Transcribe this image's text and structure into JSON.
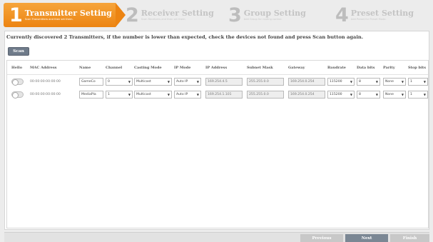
{
  "steps": [
    {
      "num": "1",
      "title": "Transmitter Setting",
      "sub": "Scan Transmitters and then set them."
    },
    {
      "num": "2",
      "title": "Receiver Setting",
      "sub": "Scan Receivers and then set them."
    },
    {
      "num": "3",
      "title": "Group Setting",
      "sub": "Add Group for routing control."
    },
    {
      "num": "4",
      "title": "Preset Setting",
      "sub": "Add Preset for Preset Mode."
    }
  ],
  "notice": "Currently discovered 2 Transmitters, if the number is lower than expected, check the devices not found and press Scan button again.",
  "scan_label": "Scan",
  "columns": [
    "Hello",
    "MAC Address",
    "Name",
    "Channel",
    "Casting Mode",
    "IP Mode",
    "IP Address",
    "Subnet Mask",
    "Gateway",
    "Baudrate",
    "Data bits",
    "Parity",
    "Stop bits"
  ],
  "rows": [
    {
      "mac": "00:00:00:00:00:00",
      "name": "GameCo",
      "channel": "0",
      "casting": "Multicast",
      "ipmode": "Auto IP",
      "ip": "169.254.4.5",
      "subnet": "255.255.0.0",
      "gateway": "169.254.0.254",
      "baud": "115200",
      "databits": "8",
      "parity": "None",
      "stopbits": "1"
    },
    {
      "mac": "00:00:00:00:00:00",
      "name": "MediaPla",
      "channel": "1",
      "casting": "Multicast",
      "ipmode": "Auto IP",
      "ip": "169.254.1.101",
      "subnet": "255.255.0.0",
      "gateway": "169.254.0.254",
      "baud": "115200",
      "databits": "8",
      "parity": "None",
      "stopbits": "1"
    }
  ],
  "footer": {
    "previous": "Previous",
    "next": "Next",
    "finish": "Finish"
  }
}
